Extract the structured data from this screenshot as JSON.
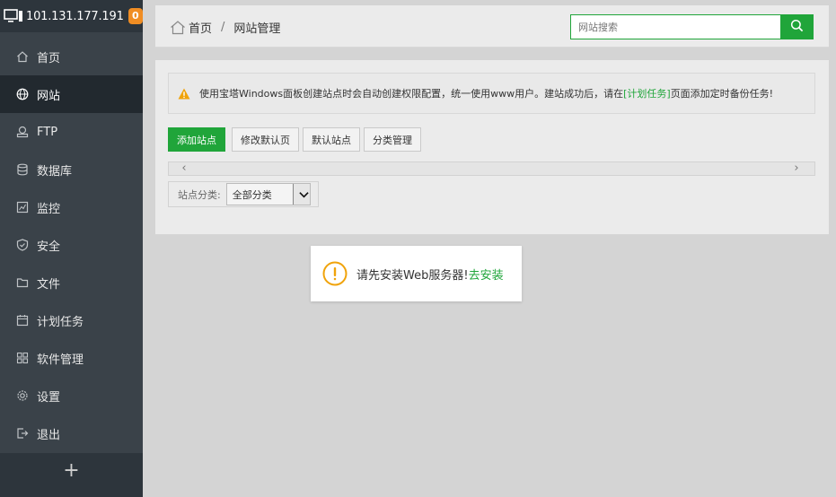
{
  "sidebar": {
    "ip": "101.131.177.191",
    "badge": "0",
    "items": [
      {
        "label": "首页",
        "icon": "home-icon"
      },
      {
        "label": "网站",
        "icon": "globe-icon"
      },
      {
        "label": "FTP",
        "icon": "ftp-icon"
      },
      {
        "label": "数据库",
        "icon": "database-icon"
      },
      {
        "label": "监控",
        "icon": "monitor-icon"
      },
      {
        "label": "安全",
        "icon": "shield-icon"
      },
      {
        "label": "文件",
        "icon": "folder-icon"
      },
      {
        "label": "计划任务",
        "icon": "calendar-icon"
      },
      {
        "label": "软件管理",
        "icon": "grid-icon"
      },
      {
        "label": "设置",
        "icon": "gear-icon"
      },
      {
        "label": "退出",
        "icon": "logout-icon"
      }
    ],
    "active_index": 1,
    "plus": "+"
  },
  "header": {
    "breadcrumb_home": "首页",
    "breadcrumb_sep": "/",
    "breadcrumb_current": "网站管理",
    "search_placeholder": "网站搜索"
  },
  "notice": {
    "text_before": "使用宝塔Windows面板创建站点时会自动创建权限配置，统一使用www用户。建站成功后，请在",
    "link": "[计划任务]",
    "text_after": "页面添加定时备份任务!"
  },
  "toolbar": {
    "add_site": "添加站点",
    "edit_default_page": "修改默认页",
    "default_site": "默认站点",
    "category_manage": "分类管理"
  },
  "filter": {
    "label": "站点分类:",
    "selected": "全部分类"
  },
  "toast": {
    "message": "请先安装Web服务器!",
    "action": "去安装"
  },
  "colors": {
    "accent": "#20a53a",
    "sidebar_bg": "#3a4249",
    "badge": "#f08d23",
    "warning": "#f0a30a"
  }
}
